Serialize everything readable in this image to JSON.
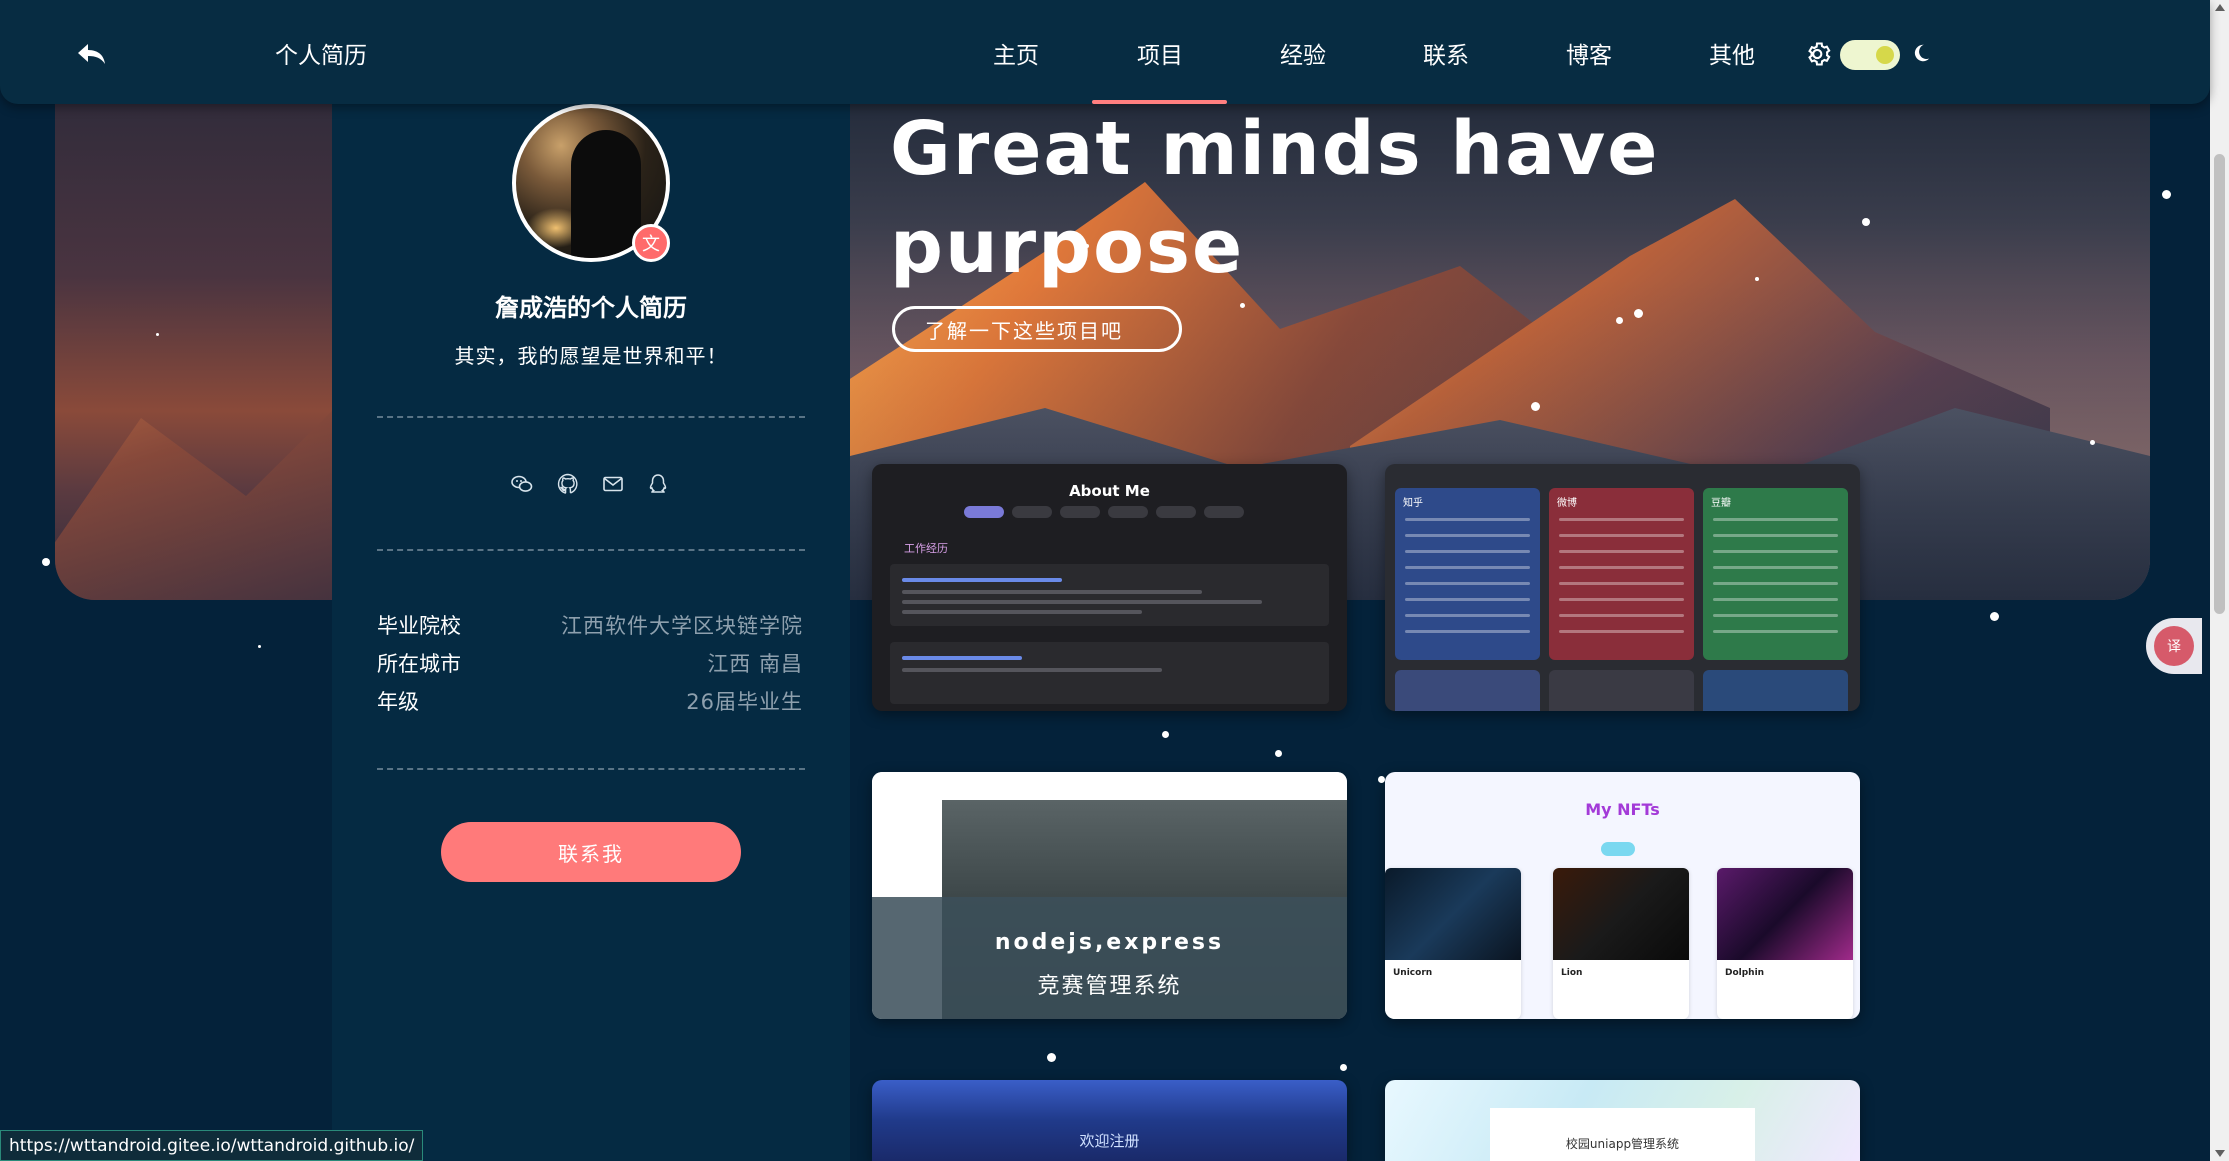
{
  "nav": {
    "brand": "个人简历",
    "items": [
      {
        "label": "主页"
      },
      {
        "label": "项目"
      },
      {
        "label": "经验"
      },
      {
        "label": "联系"
      },
      {
        "label": "博客"
      },
      {
        "label": "其他"
      }
    ],
    "active_index": 1,
    "theme": "dark"
  },
  "profile": {
    "name": "詹成浩的个人简历",
    "motto": "其实，我的愿望是世界和平！",
    "lang_badge": "文",
    "info": [
      {
        "label": "毕业院校",
        "value": "江西软件大学区块链学院"
      },
      {
        "label": "所在城市",
        "value": "江西 南昌"
      },
      {
        "label": "年级",
        "value": "26届毕业生"
      }
    ],
    "contact_button": "联系我",
    "social_icons": [
      "wechat-icon",
      "github-icon",
      "mail-icon",
      "qq-icon"
    ]
  },
  "hero": {
    "title": "Great minds have purpose",
    "button": "了解一下这些项目吧"
  },
  "projects": [
    {
      "title": "About Me",
      "section": "工作经历"
    },
    {
      "columns": [
        "知乎",
        "微博",
        "豆瓣"
      ]
    },
    {
      "tech": "nodejs,express",
      "name": "竞赛管理系统"
    },
    {
      "title": "My NFTs",
      "items": [
        "Unicorn",
        "Lion",
        "Dolphin"
      ]
    },
    {
      "name": "欢迎注册"
    },
    {
      "name": "校园uniapp管理系统"
    }
  ],
  "status_bar": {
    "url": "https://wttandroid.gitee.io/wttandroid.github.io/"
  },
  "colors": {
    "accent": "#ff7a7a",
    "background": "#04223a",
    "nav": "#072c42"
  }
}
